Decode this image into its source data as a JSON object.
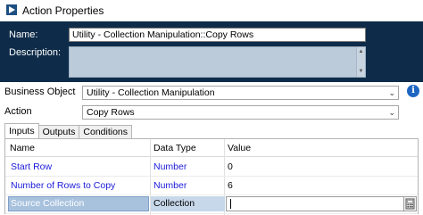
{
  "window": {
    "title": "Action Properties",
    "icon": "blueprism-action-icon"
  },
  "header": {
    "name_label": "Name:",
    "name_value": "Utility - Collection Manipulation::Copy Rows",
    "description_label": "Description:",
    "description_value": ""
  },
  "form": {
    "business_object_label": "Business Object",
    "business_object_value": "Utility - Collection Manipulation",
    "action_label": "Action",
    "action_value": "Copy Rows"
  },
  "tabs": [
    {
      "label": "Inputs",
      "active": true
    },
    {
      "label": "Outputs",
      "active": false
    },
    {
      "label": "Conditions",
      "active": false
    }
  ],
  "grid": {
    "columns": [
      "Name",
      "Data Type",
      "Value"
    ],
    "rows": [
      {
        "name": "Start Row",
        "type": "Number",
        "value": "0"
      },
      {
        "name": "Number of Rows to Copy",
        "type": "Number",
        "value": "6"
      },
      {
        "name": "Source Collection",
        "type": "Collection",
        "value": ""
      }
    ]
  },
  "colors": {
    "header_background": "#0e2c4a",
    "link_text": "#1a1adb",
    "selected_row": "#a8c2de"
  }
}
